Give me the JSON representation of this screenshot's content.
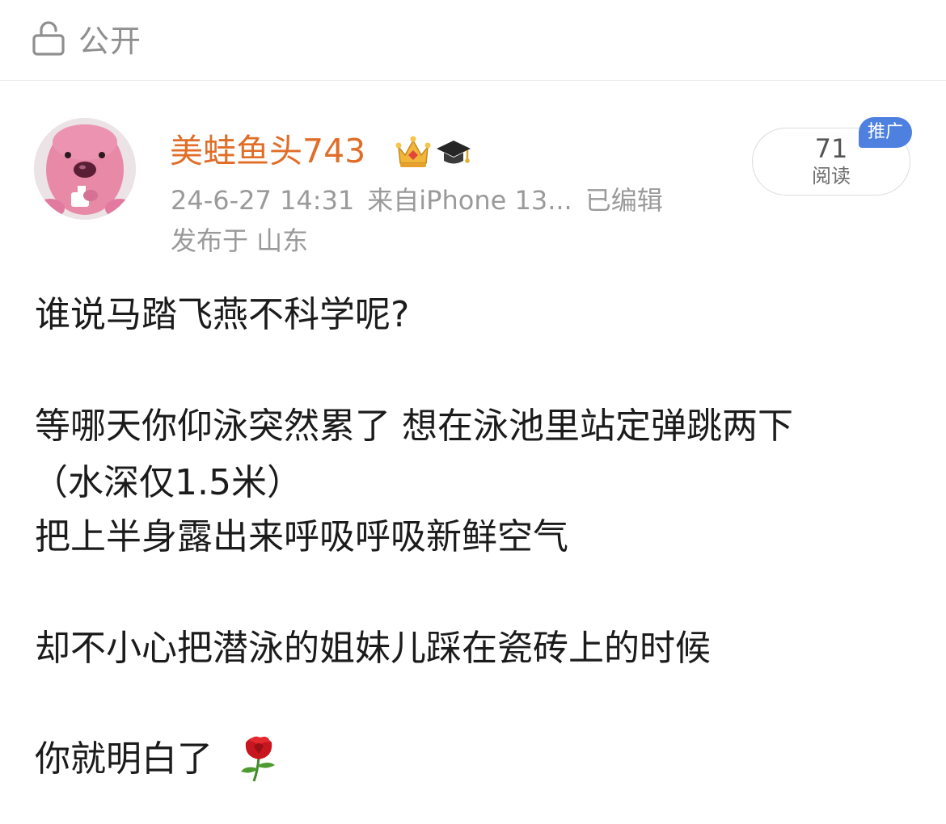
{
  "visibility": {
    "icon": "lock-open-icon",
    "label": "公开"
  },
  "author": {
    "avatar": "pink-beaver-avatar",
    "name": "美蛙鱼头743",
    "name_color": "#e06e28",
    "badges": [
      "crown-icon",
      "graduation-cap-icon"
    ]
  },
  "meta": {
    "timestamp": "24-6-27 14:31",
    "source": "来自iPhone 13...",
    "edited": "已编辑",
    "location": "发布于 山东"
  },
  "stats": {
    "read_count": "71",
    "read_label": "阅读",
    "promo_label": "推广",
    "promo_color": "#4e80e0"
  },
  "post": {
    "lines": [
      "谁说马踏飞燕不科学呢?",
      "等哪天你仰泳突然累了 想在泳池里站定弹跳两下",
      "（水深仅1.5米）",
      "把上半身露出来呼吸呼吸新鲜空气",
      "却不小心把潜泳的姐妹儿踩在瓷砖上的时候",
      "你就明白了"
    ],
    "trailing_emoji": "rose-icon"
  }
}
